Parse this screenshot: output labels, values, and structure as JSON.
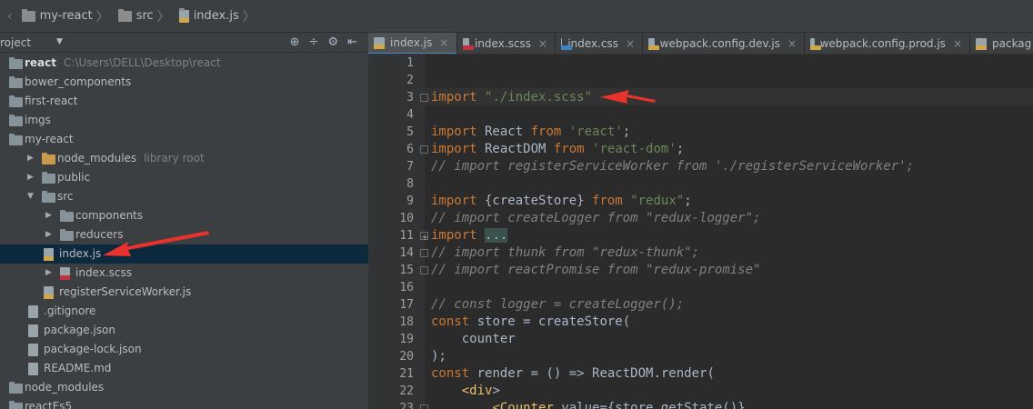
{
  "breadcrumb": [
    "my-react",
    "src",
    "index.js"
  ],
  "project": {
    "title": "roject",
    "tools": [
      "⊕",
      "÷",
      "⚙",
      "⇤"
    ]
  },
  "tree": [
    {
      "label": "react",
      "hint": "C:\\Users\\DELL\\Desktop\\react",
      "bold": true,
      "type": "folder",
      "arrow": ""
    },
    {
      "label": "bower_components",
      "type": "folder",
      "arrow": ""
    },
    {
      "label": "first-react",
      "type": "folder",
      "arrow": ""
    },
    {
      "label": "imgs",
      "type": "folder",
      "arrow": ""
    },
    {
      "label": "my-react",
      "type": "folder",
      "arrow": ""
    },
    {
      "label": "node_modules",
      "hint": "library root",
      "type": "folder-orange",
      "arrow": "▶"
    },
    {
      "label": "public",
      "type": "folder",
      "arrow": "▶"
    },
    {
      "label": "src",
      "type": "folder",
      "arrow": "▼"
    },
    {
      "label": "components",
      "type": "folder",
      "arrow": "▶"
    },
    {
      "label": "reducers",
      "type": "folder",
      "arrow": "▶"
    },
    {
      "label": "index.js",
      "type": "file-js",
      "arrow": "",
      "selected": true
    },
    {
      "label": "index.scss",
      "type": "file-scss",
      "arrow": "▶"
    },
    {
      "label": "registerServiceWorker.js",
      "type": "file-js",
      "arrow": ""
    },
    {
      "label": ".gitignore",
      "type": "file",
      "arrow": ""
    },
    {
      "label": "package.json",
      "type": "file",
      "arrow": ""
    },
    {
      "label": "package-lock.json",
      "type": "file",
      "arrow": ""
    },
    {
      "label": "README.md",
      "type": "file",
      "arrow": ""
    },
    {
      "label": "node_modules",
      "type": "folder",
      "arrow": ""
    },
    {
      "label": "reactEs5",
      "type": "folder",
      "arrow": ""
    }
  ],
  "tabs": [
    {
      "label": "index.js",
      "type": "js",
      "active": true
    },
    {
      "label": "index.scss",
      "type": "scss"
    },
    {
      "label": "index.css",
      "type": "css"
    },
    {
      "label": "webpack.config.dev.js",
      "type": "js"
    },
    {
      "label": "webpack.config.prod.js",
      "type": "js"
    },
    {
      "label": "packag",
      "type": "js"
    }
  ],
  "code": {
    "line_numbers": [
      "1",
      "2",
      "3",
      "4",
      "5",
      "6",
      "7",
      "8",
      "9",
      "10",
      "11",
      "14",
      "15",
      "16",
      "17",
      "18",
      "19",
      "20",
      "21",
      "22",
      "23"
    ],
    "lines": [
      "",
      "",
      "import \"./index.scss\"",
      "",
      "import React from 'react';",
      "import ReactDOM from 'react-dom';",
      "// import registerServiceWorker from './registerServiceWorker';",
      "",
      "import {createStore} from \"redux\";",
      "// import createLogger from \"redux-logger\";",
      "import ...",
      "// import thunk from \"redux-thunk\";",
      "// import reactPromise from \"redux-promise\"",
      "",
      "// const logger = createLogger();",
      "const store = createStore(",
      "    counter",
      ");",
      "const render = () => ReactDOM.render(",
      "    <div>",
      "        <Counter value={store.getState()}"
    ]
  },
  "colors": {
    "keyword": "#cc7832",
    "string": "#6a8759",
    "comment": "#808080",
    "annotation_arrow": "#e8322b"
  }
}
